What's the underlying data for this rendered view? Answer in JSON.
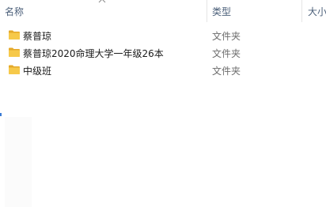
{
  "columns": {
    "name_label": "名称",
    "type_label": "类型",
    "size_label": "大小"
  },
  "files": [
    {
      "name": "蔡普琼",
      "type": "文件夹",
      "icon": "folder-icon"
    },
    {
      "name": "蔡普琼2020命理大学一年级26本",
      "type": "文件夹",
      "icon": "folder-icon"
    },
    {
      "name": "中级班",
      "type": "文件夹",
      "icon": "folder-icon"
    }
  ],
  "colors": {
    "folder_yellow": "#F6C94A",
    "folder_dark": "#E4A92A",
    "header_text": "#4C607A",
    "type_text": "#6D6D6D"
  }
}
